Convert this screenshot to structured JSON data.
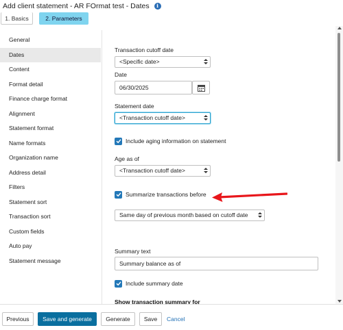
{
  "dialog": {
    "title": "Add client statement - AR FOrmat test - Dates",
    "info_icon": "info-icon"
  },
  "steps": [
    {
      "label": "1. Basics",
      "active": false
    },
    {
      "label": "2. Parameters",
      "active": true
    }
  ],
  "nav": {
    "items": [
      {
        "label": "General",
        "active": false
      },
      {
        "label": "Dates",
        "active": true
      },
      {
        "label": "Content",
        "active": false
      },
      {
        "label": "Format detail",
        "active": false
      },
      {
        "label": "Finance charge format",
        "active": false
      },
      {
        "label": "Alignment",
        "active": false
      },
      {
        "label": "Statement format",
        "active": false
      },
      {
        "label": "Name formats",
        "active": false
      },
      {
        "label": "Organization name",
        "active": false
      },
      {
        "label": "Address detail",
        "active": false
      },
      {
        "label": "Filters",
        "active": false
      },
      {
        "label": "Statement sort",
        "active": false
      },
      {
        "label": "Transaction sort",
        "active": false
      },
      {
        "label": "Custom fields",
        "active": false
      },
      {
        "label": "Auto pay",
        "active": false
      },
      {
        "label": "Statement message",
        "active": false
      }
    ]
  },
  "form": {
    "transaction_cutoff_label": "Transaction cutoff date",
    "transaction_cutoff_value": "<Specific date>",
    "date_label": "Date",
    "date_value": "06/30/2025",
    "calendar_icon": "calendar-icon",
    "statement_date_label": "Statement date",
    "statement_date_value": "<Transaction cutoff date>",
    "include_aging_label": "Include aging information on statement",
    "include_aging_checked": true,
    "age_as_of_label": "Age as of",
    "age_as_of_value": "<Transaction cutoff date>",
    "summarize_label": "Summarize transactions before",
    "summarize_checked": true,
    "summarize_option_value": "Same day of previous month based on cutoff date",
    "summary_text_label": "Summary text",
    "summary_text_value": "Summary balance as of",
    "include_summary_date_label": "Include summary date",
    "include_summary_date_checked": true,
    "show_summary_heading": "Show transaction summary for"
  },
  "annotation": {
    "arrow_color": "#e8161b"
  },
  "footer": {
    "previous": "Previous",
    "save_generate": "Save and generate",
    "generate": "Generate",
    "save": "Save",
    "cancel": "Cancel"
  },
  "colors": {
    "primary_button": "#0a6f9f",
    "active_step": "#7fd4ef",
    "checkbox": "#2378b8",
    "link": "#1f6fb5",
    "focus_ring": "#2fa4cf"
  }
}
